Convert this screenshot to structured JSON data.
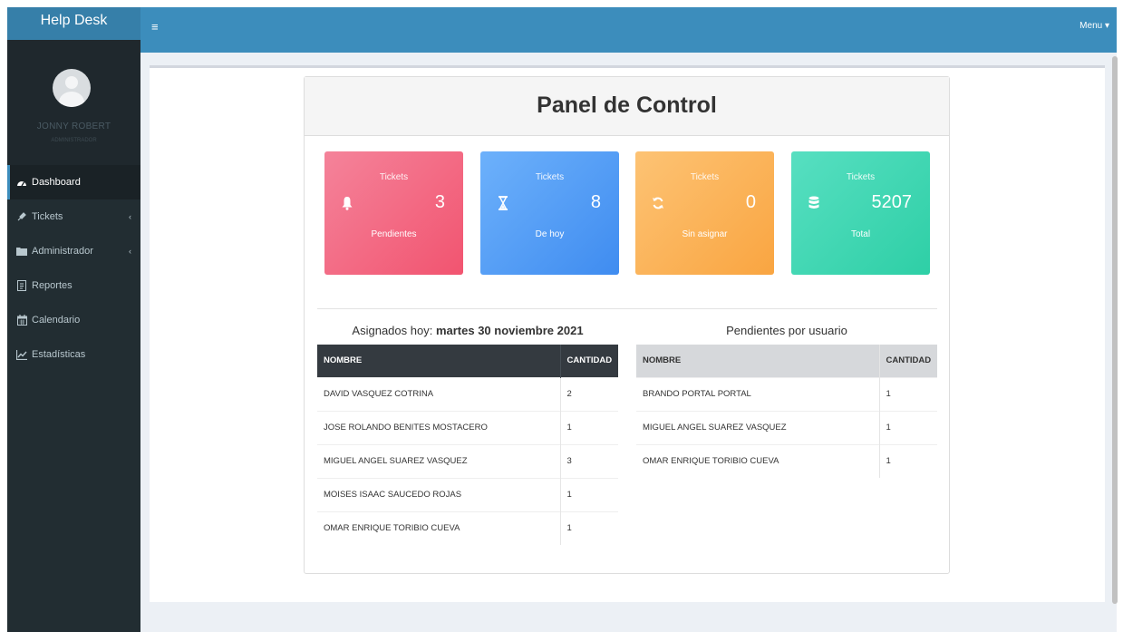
{
  "app": {
    "brand": "Help Desk"
  },
  "user": {
    "name": "JONNY ROBERT",
    "role": "ADMINISTRADOR"
  },
  "sidebar": {
    "items": [
      {
        "label": "Dashboard",
        "icon": "dashboard-icon",
        "active": true
      },
      {
        "label": "Tickets",
        "icon": "ticket-icon",
        "has_submenu": true
      },
      {
        "label": "Administrador",
        "icon": "folder-icon",
        "has_submenu": true
      },
      {
        "label": "Reportes",
        "icon": "report-icon"
      },
      {
        "label": "Calendario",
        "icon": "calendar-icon"
      },
      {
        "label": "Estadísticas",
        "icon": "chart-icon"
      }
    ]
  },
  "header": {
    "toggle_icon": "hamburger-icon",
    "menu_label": "Menu",
    "menu_icon": "caret-down-icon"
  },
  "panel": {
    "title": "Panel de Control"
  },
  "stats": [
    {
      "top": "Tickets",
      "value": "3",
      "bottom": "Pendientes",
      "icon": "bell-icon",
      "color": "#f26a7f"
    },
    {
      "top": "Tickets",
      "value": "8",
      "bottom": "De hoy",
      "icon": "hourglass-icon",
      "color": "#4b9af5"
    },
    {
      "top": "Tickets",
      "value": "0",
      "bottom": "Sin asignar",
      "icon": "refresh-icon",
      "color": "#fcb35c"
    },
    {
      "top": "Tickets",
      "value": "5207",
      "bottom": "Total",
      "icon": "database-icon",
      "color": "#3ed7b3"
    }
  ],
  "assigned_today": {
    "title_prefix": "Asignados hoy:",
    "title_date": "martes 30 noviembre 2021",
    "columns": [
      "NOMBRE",
      "CANTIDAD"
    ],
    "rows": [
      [
        "DAVID VASQUEZ COTRINA",
        "2"
      ],
      [
        "JOSE ROLANDO BENITES MOSTACERO",
        "1"
      ],
      [
        "MIGUEL ANGEL SUAREZ VASQUEZ",
        "3"
      ],
      [
        "MOISES ISAAC SAUCEDO ROJAS",
        "1"
      ],
      [
        "OMAR ENRIQUE TORIBIO CUEVA",
        "1"
      ]
    ]
  },
  "pending_by_user": {
    "title": "Pendientes por usuario",
    "columns": [
      "NOMBRE",
      "CANTIDAD"
    ],
    "rows": [
      [
        "BRANDO PORTAL PORTAL",
        "1"
      ],
      [
        "MIGUEL ANGEL SUAREZ VASQUEZ",
        "1"
      ],
      [
        "OMAR ENRIQUE TORIBIO CUEVA",
        "1"
      ]
    ]
  }
}
